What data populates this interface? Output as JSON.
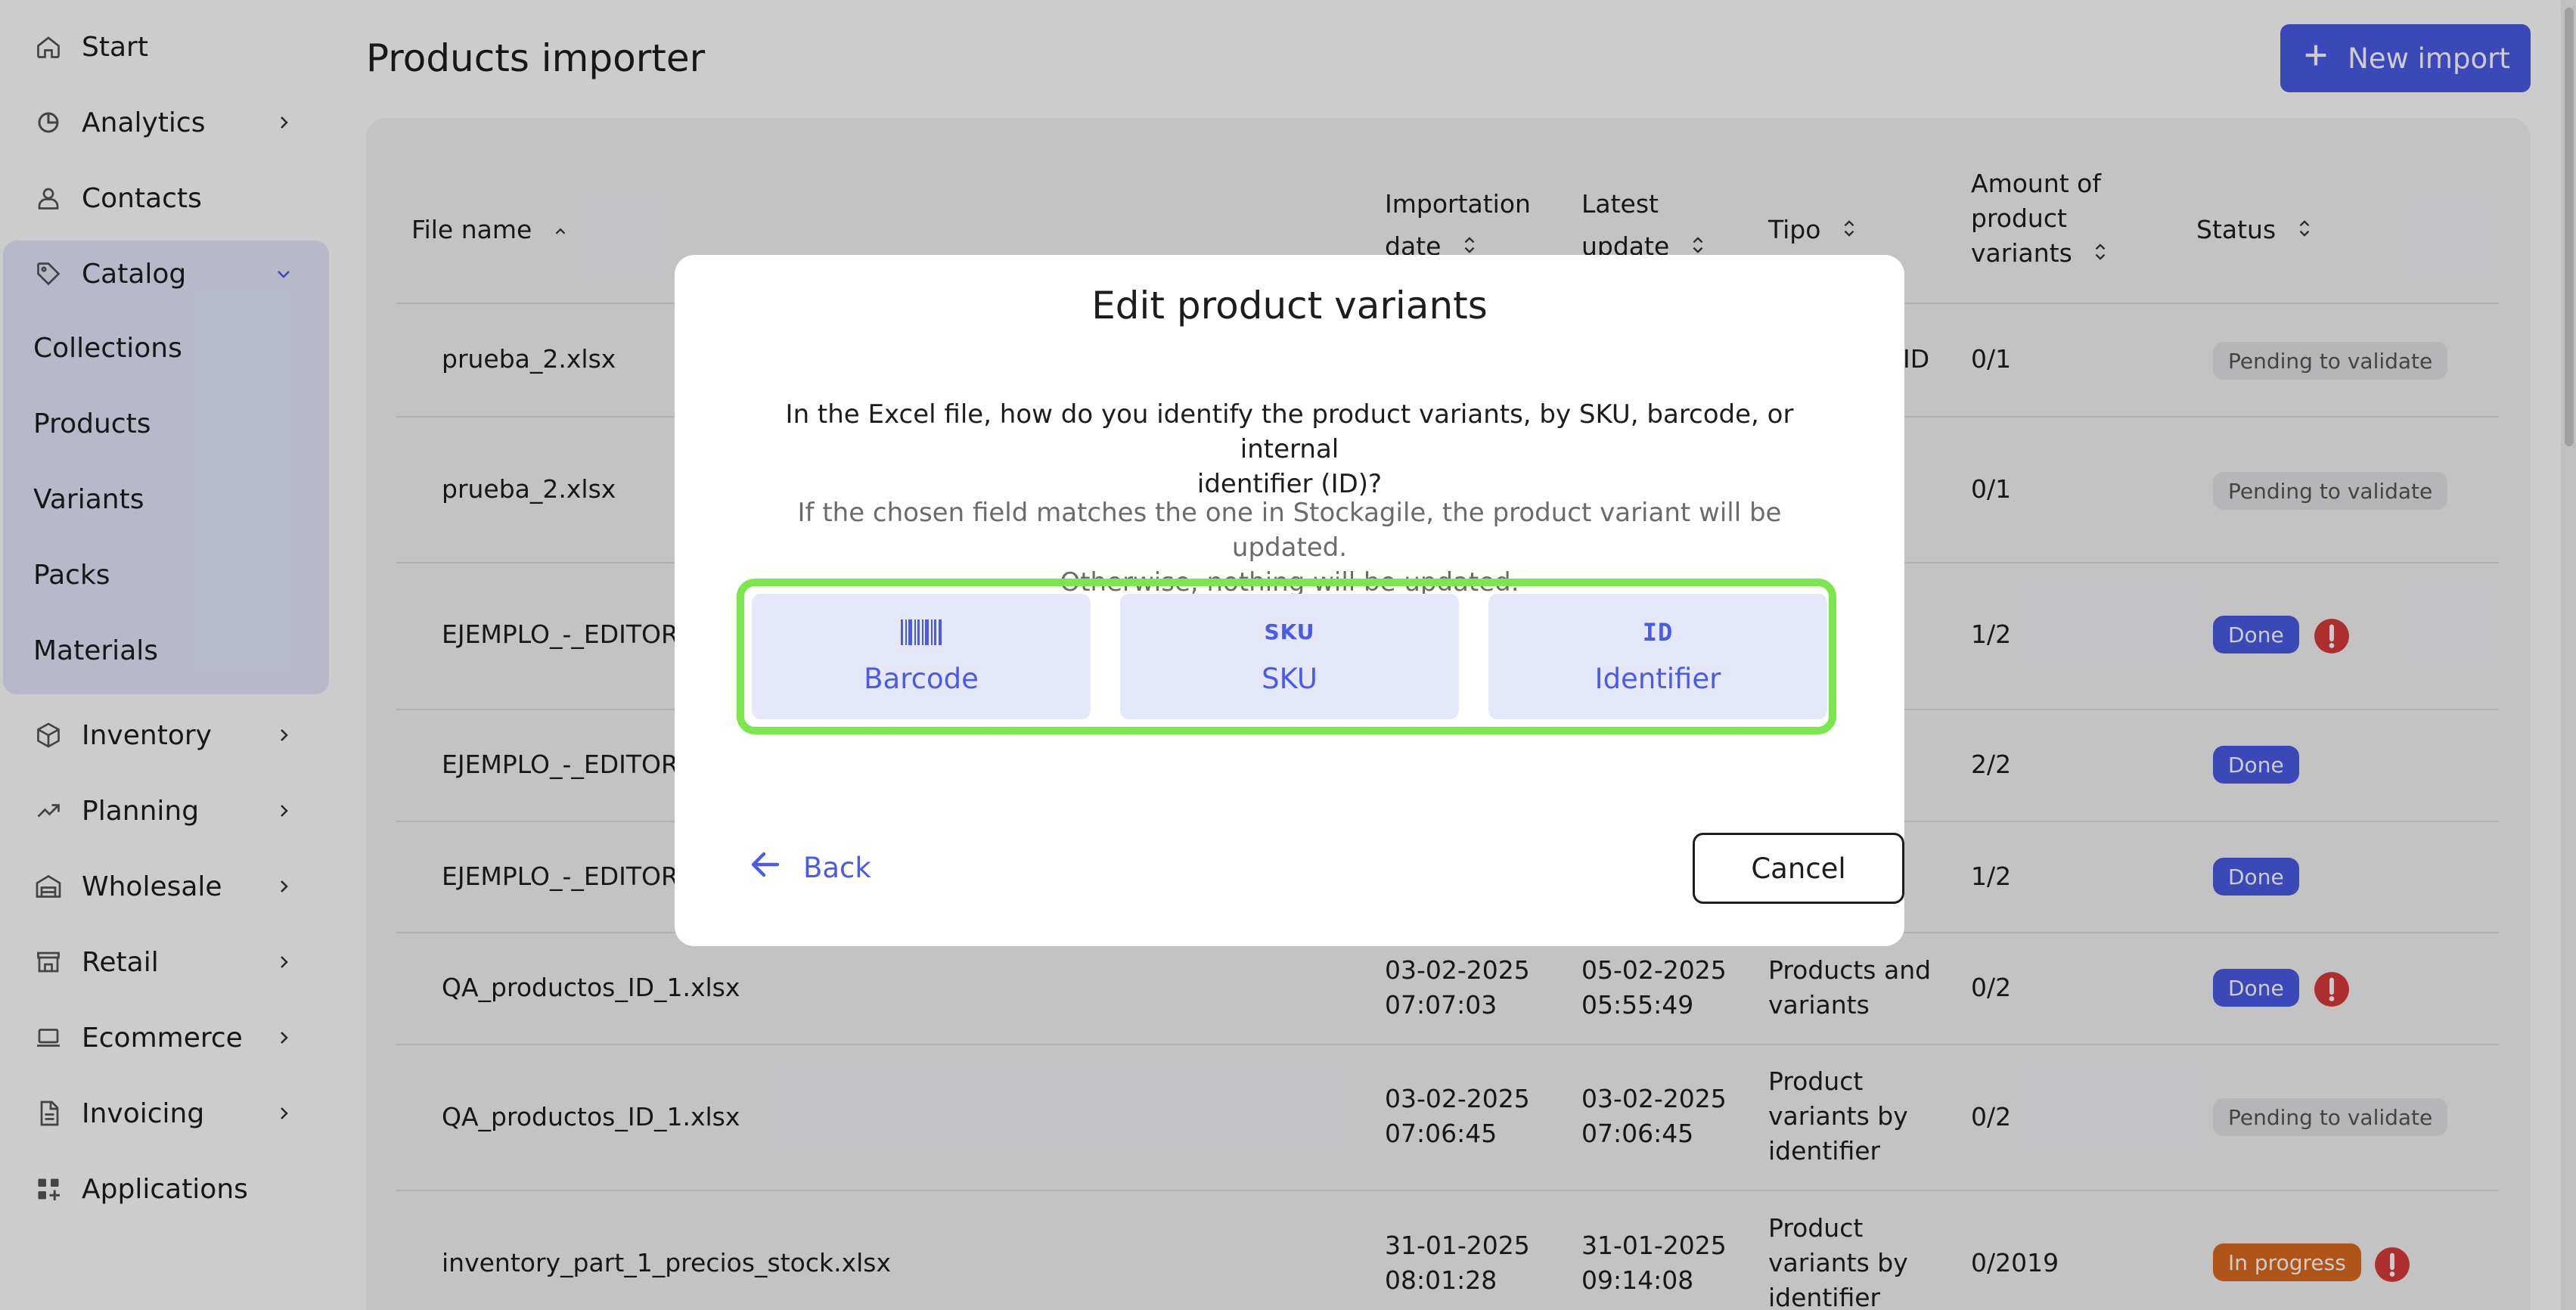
{
  "sidebar": {
    "start": {
      "label": "Start",
      "icon": "home-icon"
    },
    "analytics": {
      "label": "Analytics",
      "icon": "analytics-icon"
    },
    "contacts": {
      "label": "Contacts",
      "icon": "contact-icon"
    },
    "catalog": {
      "label": "Catalog",
      "icon": "tag-icon",
      "expanded": true,
      "children": [
        "Collections",
        "Products",
        "Variants",
        "Packs",
        "Materials"
      ]
    },
    "inventory": {
      "label": "Inventory",
      "icon": "box-icon"
    },
    "planning": {
      "label": "Planning",
      "icon": "trend-icon"
    },
    "wholesale": {
      "label": "Wholesale",
      "icon": "warehouse-icon"
    },
    "retail": {
      "label": "Retail",
      "icon": "store-icon"
    },
    "ecommerce": {
      "label": "Ecommerce",
      "icon": "laptop-icon"
    },
    "invoicing": {
      "label": "Invoicing",
      "icon": "document-icon"
    },
    "applications": {
      "label": "Applications",
      "icon": "apps-icon"
    }
  },
  "header": {
    "title": "Products importer",
    "new_import_label": "New import"
  },
  "table": {
    "columns": {
      "file_name": "File name",
      "importation_date_1": "Importation",
      "importation_date_2": "date",
      "latest_update_1": "Latest",
      "latest_update_2": "update",
      "tipo": "Tipo",
      "amount_1": "Amount of",
      "amount_2": "product",
      "amount_3": "variants",
      "status": "Status"
    },
    "rows": [
      {
        "file": "prueba_2.xlsx",
        "tipo_visible": "ID",
        "amount": "0/1",
        "status": "Pending to validate"
      },
      {
        "file": "prueba_2.xlsx",
        "amount": "0/1",
        "status": "Pending to validate"
      },
      {
        "file": "EJEMPLO_-_EDITOR",
        "amount": "1/2",
        "status": "Done",
        "warning": true
      },
      {
        "file": "EJEMPLO_-_EDITOR",
        "amount": "2/2",
        "status": "Done"
      },
      {
        "file": "EJEMPLO_-_EDITOR",
        "amount": "1/2",
        "status": "Done"
      },
      {
        "file": "QA_productos_ID_1.xlsx",
        "imp_date": "03-02-2025",
        "imp_time": "07:07:03",
        "upd_date": "05-02-2025",
        "upd_time": "05:55:49",
        "tipo_1": "Products and",
        "tipo_2": "variants",
        "amount": "0/2",
        "status": "Done",
        "warning": true
      },
      {
        "file": "QA_productos_ID_1.xlsx",
        "imp_date": "03-02-2025",
        "imp_time": "07:06:45",
        "upd_date": "03-02-2025",
        "upd_time": "07:06:45",
        "tipo_1": "Product",
        "tipo_2": "variants by",
        "tipo_3": "identifier",
        "amount": "0/2",
        "status": "Pending to validate"
      },
      {
        "file": "inventory_part_1_precios_stock.xlsx",
        "imp_date": "31-01-2025",
        "imp_time": "08:01:28",
        "upd_date": "31-01-2025",
        "upd_time": "09:14:08",
        "tipo_1": "Product",
        "tipo_2": "variants by",
        "tipo_3": "identifier",
        "amount": "0/2019",
        "status": "In progress",
        "warning": true
      }
    ]
  },
  "modal": {
    "title": "Edit product variants",
    "question_line1": "In the Excel file, how do you identify the product variants, by SKU, barcode, or internal",
    "question_line2": "identifier (ID)?",
    "hint_line1": "If the chosen field matches the one in Stockagile, the product variant will be updated.",
    "hint_line2": "Otherwise, nothing will be updated.",
    "options": [
      {
        "label": "Barcode",
        "icon": "barcode-icon"
      },
      {
        "label": "SKU",
        "icon": "sku-icon",
        "icon_text": "SKU"
      },
      {
        "label": "Identifier",
        "icon": "id-icon",
        "icon_text": "ID"
      }
    ],
    "back_label": "Back",
    "cancel_label": "Cancel",
    "highlight_color": "#7ce64f"
  },
  "colors": {
    "accent": "#4a5be6",
    "accent_light": "#e5e8fb",
    "warning": "#d93a3a",
    "progress": "#dd6b20"
  }
}
